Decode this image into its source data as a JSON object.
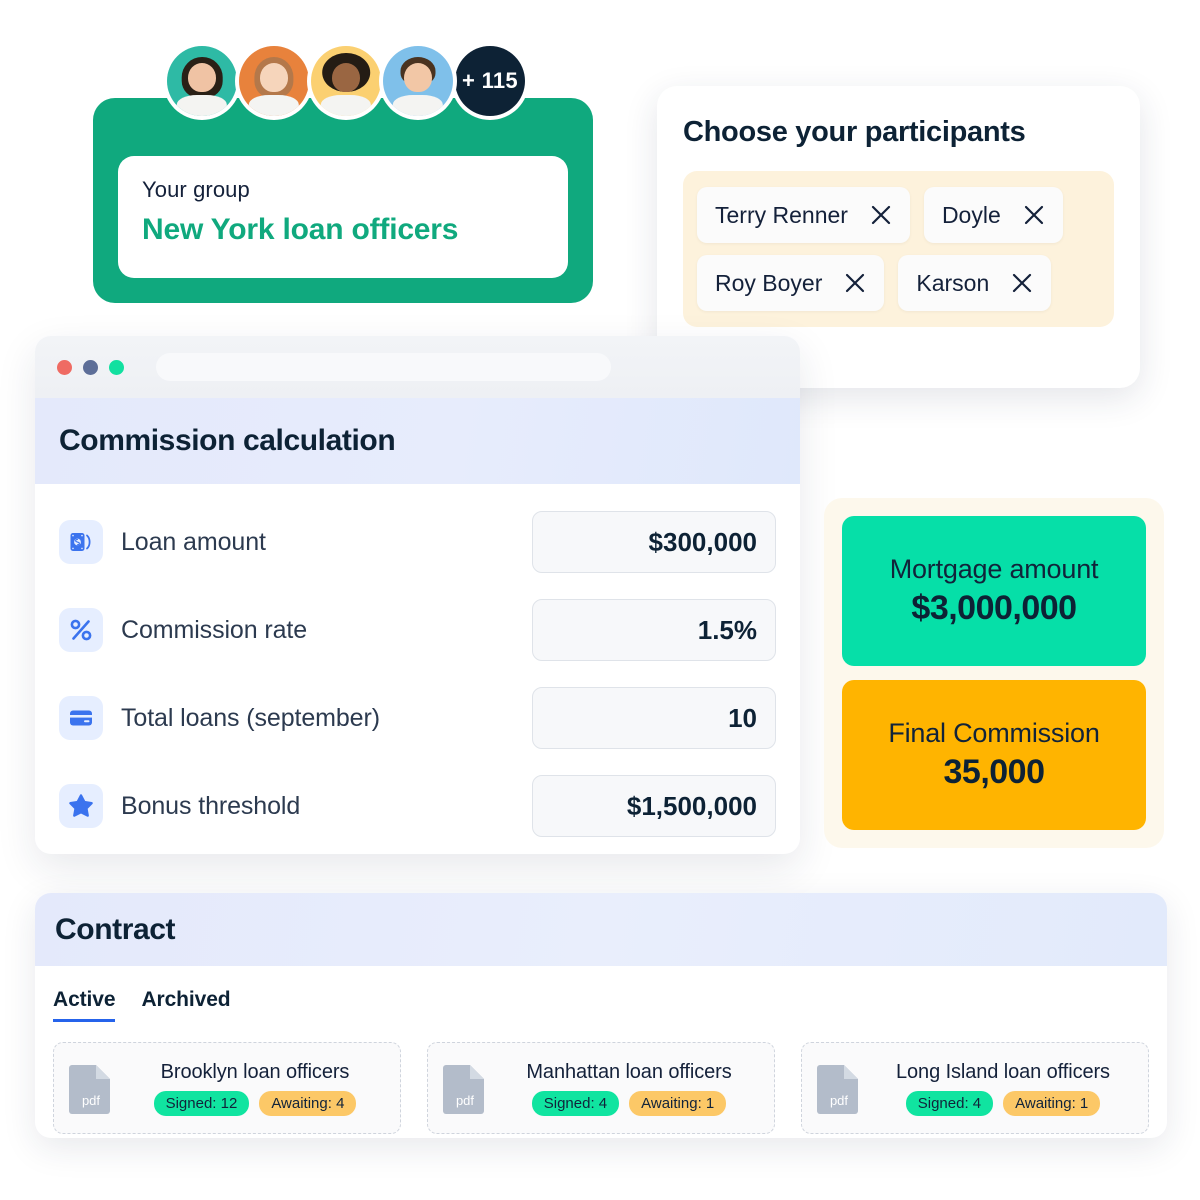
{
  "group_card": {
    "label": "Your group",
    "name": "New York loan officers",
    "more_avatars_badge": "+ 115",
    "avatar_count_visible": 4
  },
  "participants": {
    "title": "Choose your participants",
    "chips": [
      {
        "name": "Terry Renner",
        "remove_icon": "close-icon"
      },
      {
        "name": "Doyle",
        "remove_icon": "close-icon"
      },
      {
        "name": "Roy Boyer",
        "remove_icon": "close-icon"
      },
      {
        "name": "Karson",
        "remove_icon": "close-icon"
      }
    ]
  },
  "browser": {
    "traffic_lights": [
      "red",
      "blue",
      "green"
    ],
    "url_value": ""
  },
  "commission": {
    "title": "Commission calculation",
    "rows": [
      {
        "icon": "banknote-icon",
        "label": "Loan amount",
        "value": "$300,000"
      },
      {
        "icon": "percent-icon",
        "label": "Commission rate",
        "value": "1.5%"
      },
      {
        "icon": "credit-card-icon",
        "label": "Total loans (september)",
        "value": "10"
      },
      {
        "icon": "star-icon",
        "label": "Bonus threshold",
        "value": "$1,500,000"
      }
    ]
  },
  "results": [
    {
      "title": "Mortgage amount",
      "value": "$3,000,000",
      "color": "#06DFA8"
    },
    {
      "title": "Final Commission",
      "value": "35,000",
      "color": "#FFB400"
    }
  ],
  "contract": {
    "title": "Contract",
    "tabs": [
      {
        "label": "Active",
        "active": true
      },
      {
        "label": "Archived",
        "active": false
      }
    ],
    "documents": [
      {
        "file_icon": "pdf-file-icon",
        "title": "Brooklyn loan officers",
        "signed_label": "Signed: 12",
        "awaiting_label": "Awaiting: 4"
      },
      {
        "file_icon": "pdf-file-icon",
        "title": "Manhattan loan officers",
        "signed_label": "Signed: 4",
        "awaiting_label": "Awaiting: 1"
      },
      {
        "file_icon": "pdf-file-icon",
        "title": "Long Island loan officers",
        "signed_label": "Signed: 4",
        "awaiting_label": "Awaiting: 1"
      }
    ]
  },
  "colors": {
    "brand_green": "#10A97E",
    "accent_green": "#06DFA8",
    "accent_orange": "#FFB400",
    "tab_underline_blue": "#2563EB",
    "cream": "#FDF2DC",
    "icon_blue": "#3B73EE",
    "dark": "#0d2235"
  }
}
